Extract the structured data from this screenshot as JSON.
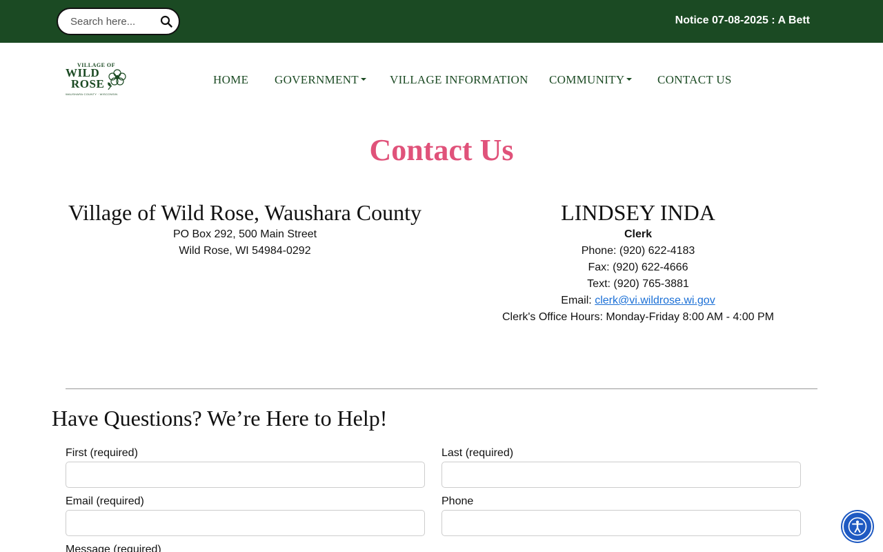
{
  "search": {
    "placeholder": "Search here..."
  },
  "notice": {
    "text": "Notice 07-08-2025 : A Bett"
  },
  "logo": {
    "line1": "VILLAGE OF",
    "line2": "WILD",
    "line3": "ROSE",
    "line4": "WAUSHARA COUNTY · WISCONSIN"
  },
  "nav": {
    "home": "HOME",
    "government": "GOVERNMENT",
    "village_information": "VILLAGE INFORMATION",
    "community": "COMMUNITY",
    "contact_us": "CONTACT US"
  },
  "page": {
    "title": "Contact Us"
  },
  "village": {
    "name": "Village of Wild Rose, Waushara County",
    "address_line1": "PO Box 292, 500 Main Street",
    "address_line2": "Wild Rose, WI 54984-0292"
  },
  "clerk": {
    "name": "LINDSEY INDA",
    "role": "Clerk",
    "phone": "Phone: (920) 622-4183",
    "fax": "Fax: (920) 622-4666",
    "text": "Text: (920) 765-3881",
    "email_label": "Email:",
    "email": "clerk@vi.wildrose.wi.gov",
    "hours": "Clerk's Office Hours: Monday-Friday 8:00 AM - 4:00 PM"
  },
  "form": {
    "title": "Have Questions? We’re Here to Help!",
    "first_label": "First (required)",
    "last_label": "Last (required)",
    "email_label": "Email (required)",
    "phone_label": "Phone",
    "message_label": "Message (required)"
  },
  "colors": {
    "brand_green": "#1b4a23",
    "title_pink": "#e0527a",
    "link_blue": "#1a6fd6",
    "accessibility_blue": "#1f5ac2"
  }
}
